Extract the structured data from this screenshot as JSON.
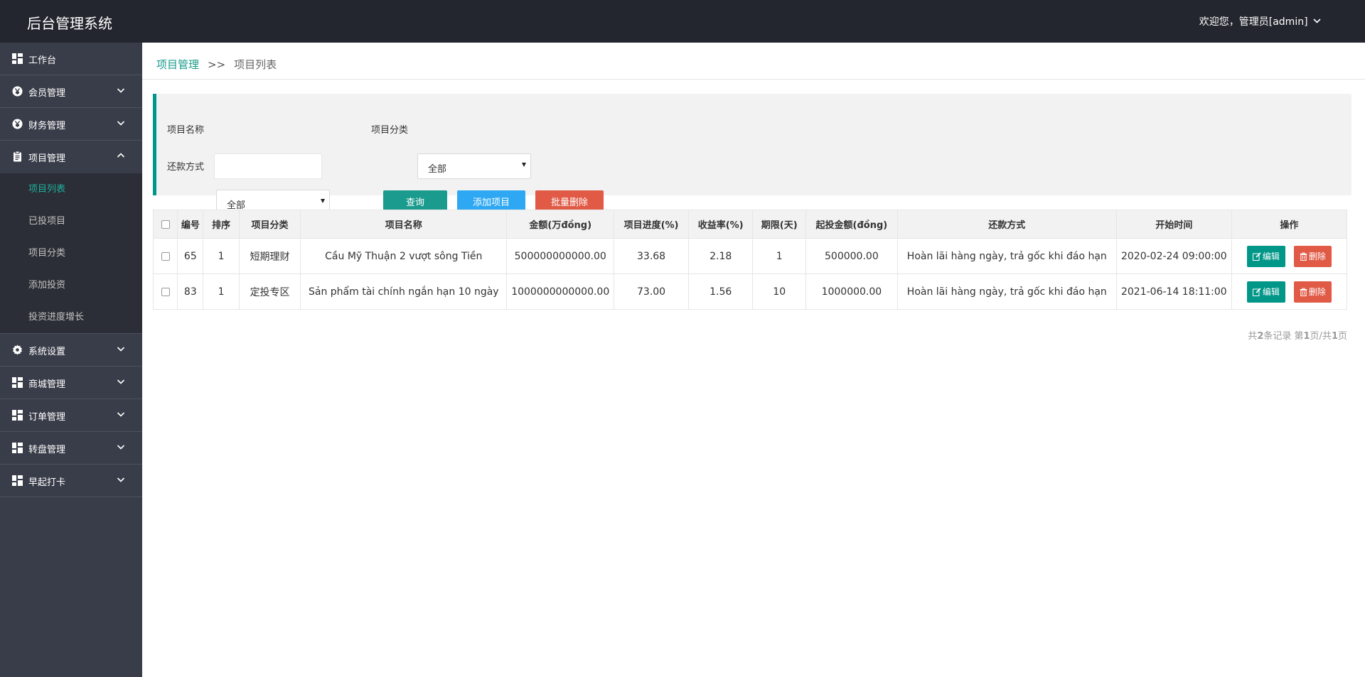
{
  "app_title": "后台管理系统",
  "user_menu": "欢迎您，管理员[admin]",
  "sidebar": {
    "items": [
      {
        "label": "工作台",
        "icon": "dashboard-icon"
      },
      {
        "label": "会员管理",
        "icon": "yen-circle-icon"
      },
      {
        "label": "财务管理",
        "icon": "yen-circle-icon"
      },
      {
        "label": "项目管理",
        "icon": "clipboard-icon",
        "expanded": true,
        "children": [
          "项目列表",
          "已投项目",
          "项目分类",
          "添加投资",
          "投资进度增长"
        ],
        "active_child": "项目列表"
      },
      {
        "label": "系统设置",
        "icon": "gear-icon"
      },
      {
        "label": "商城管理",
        "icon": "dashboard-icon"
      },
      {
        "label": "订单管理",
        "icon": "dashboard-icon"
      },
      {
        "label": "转盘管理",
        "icon": "dashboard-icon"
      },
      {
        "label": "早起打卡",
        "icon": "dashboard-icon"
      }
    ]
  },
  "breadcrumb": {
    "parent": "项目管理",
    "separator": ">>",
    "current": "项目列表"
  },
  "search": {
    "name_label": "项目名称",
    "name_value": "",
    "category_label": "项目分类",
    "category_value": "全部",
    "repay_label": "还款方式",
    "repay_value": "全部",
    "query_btn": "查询",
    "add_btn": "添加项目",
    "batch_delete_btn": "批量删除"
  },
  "table": {
    "headers": [
      "编号",
      "排序",
      "项目分类",
      "项目名称",
      "金额(万đồng)",
      "项目进度(%)",
      "收益率(%)",
      "期限(天)",
      "起投金额(đồng)",
      "还款方式",
      "开始时间",
      "操作"
    ],
    "rows": [
      [
        "65",
        "1",
        "短期理财",
        "Cầu Mỹ Thuận 2 vượt sông Tiền",
        "500000000000.00",
        "33.68",
        "2.18",
        "1",
        "500000.00",
        "Hoàn lãi hàng ngày, trả gốc khi đáo hạn",
        "2020-02-24 09:00:00"
      ],
      [
        "83",
        "1",
        "定投专区",
        "Sản phẩm tài chính ngắn hạn 10 ngày",
        "1000000000000.00",
        "73.00",
        "1.56",
        "10",
        "1000000.00",
        "Hoàn lãi hàng ngày, trả gốc khi đáo hạn",
        "2021-06-14 18:11:00"
      ]
    ],
    "edit_label": "编辑",
    "delete_label": "删除"
  },
  "pager": {
    "p1": "共",
    "total": "2",
    "p2": "条记录 第",
    "page": "1",
    "p3": "页/共",
    "pages": "1",
    "p4": "页"
  },
  "colors": {
    "topbar": "#23262e",
    "sidebar": "#393d49",
    "accent": "#009688",
    "active_link": "#1fb19e",
    "add_btn": "#2ea8f3",
    "danger": "#e05a46"
  }
}
